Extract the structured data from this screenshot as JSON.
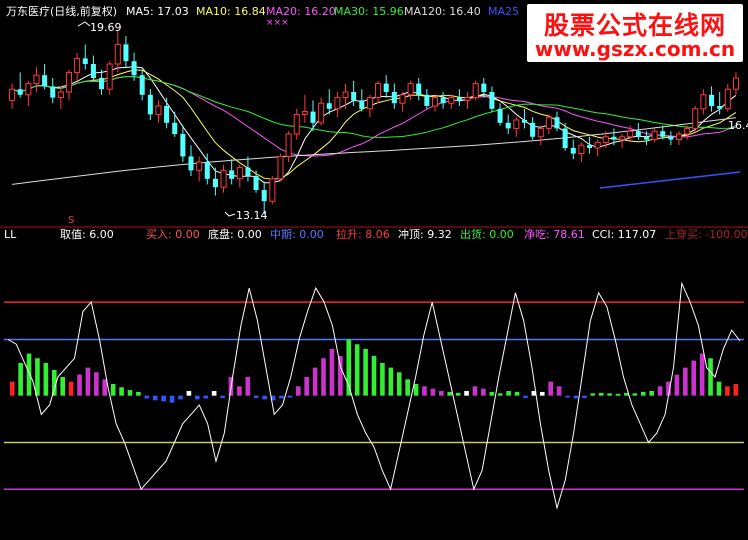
{
  "colors": {
    "background": "#000000",
    "up": "#ff3a3a",
    "down": "#54ffff",
    "ma5": "#ffffff",
    "ma10": "#ffff54",
    "ma20": "#ff54ff",
    "ma30": "#33ee33",
    "ma120": "#dddddd",
    "ma250": "#3355ff",
    "divider": "#b01010",
    "redline": "#ff2222",
    "blueline": "#5577ff",
    "yellowline": "#cccc66",
    "purpleline": "#cc33cc",
    "histRed": "#ff2222",
    "histGreen": "#33ee33",
    "histPurple": "#cc33cc",
    "histBlue": "#3355ff",
    "histWhite": "#ffffff",
    "cci": "#ffffff"
  },
  "header": {
    "title": "万东医疗(日线,前复权)",
    "ma5": "MA5: 17.03",
    "ma10": "MA10: 16.84",
    "ma20": "MA20: 16.20",
    "ma30": "MA30: 15.96",
    "ma120": "MA120: 16.40",
    "ma250": "MA25",
    "markers": "×××"
  },
  "annotations": {
    "high": "19.69",
    "low": "13.14",
    "right_price": "16.4",
    "s_marker": "S"
  },
  "indicator": {
    "name": "LL",
    "items": [
      {
        "label": "取值:",
        "value": "6.00",
        "color": "#ffffff"
      },
      {
        "label": "买入:",
        "value": "0.00",
        "color": "#ff5555"
      },
      {
        "label": "底盘:",
        "value": "0.00",
        "color": "#ffffff"
      },
      {
        "label": "中期:",
        "value": "0.00",
        "color": "#5577ff"
      },
      {
        "label": "拉升:",
        "value": "8.06",
        "color": "#ff3a3a"
      },
      {
        "label": "冲顶:",
        "value": "9.32",
        "color": "#ffffff"
      },
      {
        "label": "出货:",
        "value": "0.00",
        "color": "#33ee33"
      },
      {
        "label": "净吃:",
        "value": "78.61",
        "color": "#ff54ff"
      },
      {
        "label": "CCI:",
        "value": "117.07",
        "color": "#ffffff"
      },
      {
        "label": "上穿买:",
        "value": "-100.00",
        "color": "#aa2222"
      }
    ]
  },
  "watermark": {
    "line1": "股票公式在线网",
    "line2": "www.gszx.com.cn"
  },
  "chart_data": [
    {
      "type": "candlestick",
      "title": "万东医疗(日线,前复权)",
      "ylim": [
        13.0,
        20.0
      ],
      "moving_averages": [
        "MA5",
        "MA10",
        "MA20",
        "MA30",
        "MA120",
        "MA250"
      ],
      "candles": [
        [
          17.2,
          17.8,
          16.9,
          17.6
        ],
        [
          17.6,
          18.2,
          17.3,
          17.4
        ],
        [
          17.4,
          17.9,
          17.0,
          17.8
        ],
        [
          17.8,
          18.4,
          17.5,
          18.1
        ],
        [
          18.1,
          18.5,
          17.6,
          17.7
        ],
        [
          17.7,
          18.0,
          17.1,
          17.3
        ],
        [
          17.3,
          17.7,
          16.9,
          17.5
        ],
        [
          17.5,
          18.3,
          17.2,
          18.2
        ],
        [
          18.2,
          18.9,
          17.9,
          18.7
        ],
        [
          18.7,
          19.2,
          18.3,
          18.5
        ],
        [
          18.5,
          18.8,
          17.9,
          18.0
        ],
        [
          18.0,
          18.3,
          17.4,
          17.6
        ],
        [
          17.6,
          18.6,
          17.4,
          18.5
        ],
        [
          18.5,
          19.69,
          18.2,
          19.2
        ],
        [
          19.2,
          19.5,
          18.4,
          18.6
        ],
        [
          18.6,
          18.9,
          17.9,
          18.1
        ],
        [
          18.1,
          18.3,
          17.2,
          17.4
        ],
        [
          17.4,
          17.6,
          16.5,
          16.7
        ],
        [
          16.7,
          17.2,
          16.4,
          17.0
        ],
        [
          17.0,
          17.3,
          16.2,
          16.4
        ],
        [
          16.4,
          16.8,
          15.9,
          16.0
        ],
        [
          16.0,
          16.3,
          15.0,
          15.2
        ],
        [
          15.2,
          15.6,
          14.5,
          14.7
        ],
        [
          14.7,
          15.2,
          14.3,
          15.0
        ],
        [
          15.0,
          15.3,
          14.2,
          14.4
        ],
        [
          14.4,
          14.8,
          13.8,
          14.1
        ],
        [
          14.1,
          14.9,
          13.9,
          14.7
        ],
        [
          14.7,
          15.1,
          14.2,
          14.4
        ],
        [
          14.4,
          14.9,
          14.1,
          14.8
        ],
        [
          14.8,
          15.2,
          14.3,
          14.5
        ],
        [
          14.5,
          14.7,
          13.9,
          14.0
        ],
        [
          14.0,
          14.3,
          13.14,
          13.6
        ],
        [
          13.6,
          14.5,
          13.5,
          14.4
        ],
        [
          14.4,
          15.3,
          14.3,
          15.2
        ],
        [
          15.2,
          16.1,
          15.0,
          16.0
        ],
        [
          16.0,
          16.9,
          15.8,
          16.7
        ],
        [
          16.7,
          17.4,
          16.4,
          16.8
        ],
        [
          16.8,
          17.2,
          16.1,
          16.4
        ],
        [
          16.4,
          17.3,
          16.3,
          17.1
        ],
        [
          17.1,
          17.6,
          16.7,
          16.9
        ],
        [
          16.9,
          17.5,
          16.6,
          17.3
        ],
        [
          17.3,
          17.8,
          16.9,
          17.5
        ],
        [
          17.5,
          17.9,
          17.0,
          17.2
        ],
        [
          17.2,
          17.6,
          16.8,
          16.9
        ],
        [
          16.9,
          17.4,
          16.6,
          17.3
        ],
        [
          17.3,
          17.9,
          17.1,
          17.8
        ],
        [
          17.8,
          18.1,
          17.3,
          17.5
        ],
        [
          17.5,
          17.8,
          16.9,
          17.1
        ],
        [
          17.1,
          17.5,
          16.8,
          17.4
        ],
        [
          17.4,
          17.9,
          17.2,
          17.8
        ],
        [
          17.8,
          18.0,
          17.2,
          17.4
        ],
        [
          17.4,
          17.6,
          16.9,
          17.0
        ],
        [
          17.0,
          17.4,
          16.8,
          17.3
        ],
        [
          17.3,
          17.5,
          16.9,
          17.1
        ],
        [
          17.1,
          17.4,
          16.9,
          17.3
        ],
        [
          17.3,
          17.6,
          17.0,
          17.2
        ],
        [
          17.2,
          17.5,
          16.9,
          17.3
        ],
        [
          17.3,
          17.9,
          17.2,
          17.8
        ],
        [
          17.8,
          18.0,
          17.3,
          17.5
        ],
        [
          17.5,
          17.7,
          16.8,
          16.9
        ],
        [
          16.9,
          17.1,
          16.3,
          16.4
        ],
        [
          16.4,
          16.7,
          16.0,
          16.2
        ],
        [
          16.2,
          16.6,
          15.9,
          16.5
        ],
        [
          16.5,
          16.9,
          16.2,
          16.4
        ],
        [
          16.4,
          16.6,
          15.8,
          15.9
        ],
        [
          15.9,
          16.3,
          15.6,
          16.2
        ],
        [
          16.2,
          16.7,
          16.0,
          16.6
        ],
        [
          16.6,
          16.8,
          16.1,
          16.2
        ],
        [
          16.2,
          16.4,
          15.4,
          15.5
        ],
        [
          15.5,
          15.8,
          15.1,
          15.3
        ],
        [
          15.3,
          15.7,
          15.0,
          15.6
        ],
        [
          15.6,
          15.9,
          15.3,
          15.5
        ],
        [
          15.5,
          15.8,
          15.2,
          15.7
        ],
        [
          15.7,
          16.1,
          15.5,
          15.9
        ],
        [
          15.9,
          16.2,
          15.6,
          15.8
        ],
        [
          15.8,
          16.0,
          15.5,
          15.9
        ],
        [
          15.9,
          16.3,
          15.7,
          16.1
        ],
        [
          16.1,
          16.4,
          15.8,
          15.9
        ],
        [
          15.9,
          16.1,
          15.6,
          15.8
        ],
        [
          15.8,
          16.2,
          15.7,
          16.1
        ],
        [
          16.1,
          16.3,
          15.8,
          15.9
        ],
        [
          15.9,
          16.1,
          15.6,
          15.8
        ],
        [
          15.8,
          16.1,
          15.6,
          16.0
        ],
        [
          16.0,
          16.3,
          15.8,
          16.2
        ],
        [
          16.2,
          17.0,
          16.1,
          16.9
        ],
        [
          16.9,
          17.6,
          16.7,
          17.4
        ],
        [
          17.4,
          17.7,
          16.8,
          17.0
        ],
        [
          17.0,
          17.5,
          16.7,
          16.9
        ],
        [
          16.9,
          17.8,
          16.8,
          17.6
        ],
        [
          17.6,
          18.2,
          17.4,
          18.0
        ]
      ]
    },
    {
      "type": "bar",
      "title": "LL",
      "ylim": [
        -300,
        320
      ],
      "reference_lines": [
        200,
        120,
        -100,
        -200
      ],
      "bars": [
        [
          1,
          30,
          "red"
        ],
        [
          2,
          70,
          "green"
        ],
        [
          3,
          90,
          "green"
        ],
        [
          4,
          80,
          "green"
        ],
        [
          5,
          70,
          "green"
        ],
        [
          6,
          55,
          "green"
        ],
        [
          7,
          40,
          "green"
        ],
        [
          8,
          30,
          "red"
        ],
        [
          9,
          45,
          "purple"
        ],
        [
          10,
          60,
          "purple"
        ],
        [
          11,
          50,
          "purple"
        ],
        [
          12,
          35,
          "purple"
        ],
        [
          13,
          25,
          "green"
        ],
        [
          14,
          18,
          "green"
        ],
        [
          15,
          12,
          "green"
        ],
        [
          16,
          8,
          "green"
        ],
        [
          17,
          -6,
          "blue"
        ],
        [
          18,
          -10,
          "blue"
        ],
        [
          19,
          -12,
          "blue"
        ],
        [
          20,
          -15,
          "blue"
        ],
        [
          21,
          -8,
          "blue"
        ],
        [
          22,
          10,
          "white"
        ],
        [
          23,
          -8,
          "blue"
        ],
        [
          24,
          -6,
          "blue"
        ],
        [
          25,
          10,
          "white"
        ],
        [
          26,
          -5,
          "blue"
        ],
        [
          27,
          40,
          "purple"
        ],
        [
          28,
          20,
          "purple"
        ],
        [
          29,
          40,
          "purple"
        ],
        [
          30,
          -5,
          "blue"
        ],
        [
          31,
          -8,
          "blue"
        ],
        [
          32,
          -10,
          "blue"
        ],
        [
          33,
          -6,
          "blue"
        ],
        [
          34,
          -4,
          "blue"
        ],
        [
          35,
          20,
          "purple"
        ],
        [
          36,
          40,
          "purple"
        ],
        [
          37,
          60,
          "purple"
        ],
        [
          38,
          80,
          "purple"
        ],
        [
          39,
          100,
          "purple"
        ],
        [
          40,
          85,
          "purple"
        ],
        [
          41,
          120,
          "green"
        ],
        [
          42,
          110,
          "green"
        ],
        [
          43,
          100,
          "green"
        ],
        [
          44,
          85,
          "green"
        ],
        [
          45,
          70,
          "green"
        ],
        [
          46,
          60,
          "green"
        ],
        [
          47,
          50,
          "green"
        ],
        [
          48,
          35,
          "green"
        ],
        [
          49,
          25,
          "green"
        ],
        [
          50,
          20,
          "purple"
        ],
        [
          51,
          15,
          "purple"
        ],
        [
          52,
          10,
          "purple"
        ],
        [
          53,
          8,
          "green"
        ],
        [
          54,
          6,
          "green"
        ],
        [
          55,
          10,
          "white"
        ],
        [
          56,
          20,
          "purple"
        ],
        [
          57,
          15,
          "purple"
        ],
        [
          58,
          8,
          "green"
        ],
        [
          59,
          5,
          "green"
        ],
        [
          60,
          10,
          "green"
        ],
        [
          61,
          8,
          "green"
        ],
        [
          62,
          -5,
          "blue"
        ],
        [
          63,
          10,
          "white"
        ],
        [
          64,
          8,
          "white"
        ],
        [
          65,
          30,
          "purple"
        ],
        [
          66,
          20,
          "purple"
        ],
        [
          67,
          -4,
          "blue"
        ],
        [
          68,
          -6,
          "blue"
        ],
        [
          69,
          -5,
          "blue"
        ],
        [
          70,
          5,
          "green"
        ],
        [
          71,
          6,
          "green"
        ],
        [
          72,
          5,
          "green"
        ],
        [
          73,
          4,
          "green"
        ],
        [
          74,
          6,
          "green"
        ],
        [
          75,
          5,
          "green"
        ],
        [
          76,
          8,
          "green"
        ],
        [
          77,
          10,
          "green"
        ],
        [
          78,
          20,
          "purple"
        ],
        [
          79,
          30,
          "purple"
        ],
        [
          80,
          45,
          "purple"
        ],
        [
          81,
          60,
          "purple"
        ],
        [
          82,
          75,
          "purple"
        ],
        [
          83,
          90,
          "purple"
        ],
        [
          84,
          80,
          "green"
        ],
        [
          85,
          30,
          "green"
        ],
        [
          86,
          20,
          "red"
        ],
        [
          87,
          25,
          "red"
        ]
      ],
      "cci": [
        120,
        110,
        70,
        30,
        -40,
        -20,
        40,
        60,
        80,
        180,
        200,
        120,
        20,
        -60,
        -100,
        -150,
        -200,
        -180,
        -160,
        -140,
        -100,
        -60,
        -40,
        -20,
        -60,
        -140,
        -80,
        40,
        150,
        230,
        160,
        60,
        -40,
        -20,
        40,
        120,
        180,
        230,
        200,
        150,
        60,
        20,
        -40,
        -80,
        -110,
        -160,
        -200,
        -120,
        -40,
        40,
        130,
        200,
        120,
        40,
        -40,
        -120,
        -200,
        -160,
        -60,
        40,
        130,
        220,
        160,
        60,
        -60,
        -160,
        -240,
        -180,
        -80,
        40,
        160,
        220,
        190,
        120,
        40,
        -20,
        -60,
        -100,
        -80,
        -40,
        60,
        240,
        200,
        150,
        60,
        40,
        100,
        140,
        117
      ]
    }
  ]
}
